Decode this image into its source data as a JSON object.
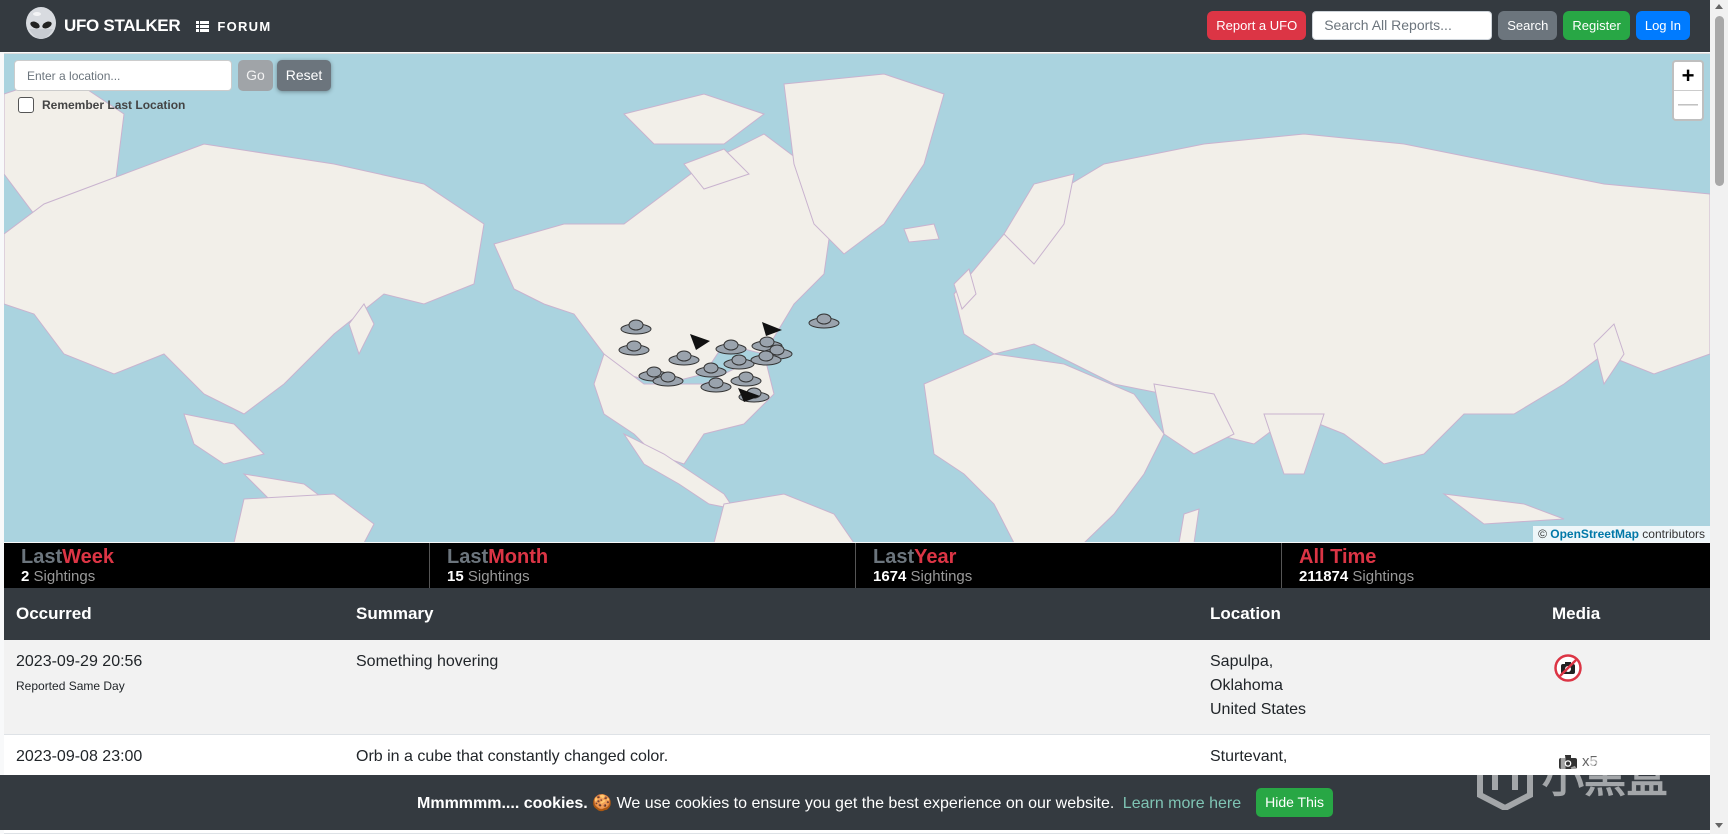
{
  "header": {
    "brand": "UFO STALKER",
    "forum_label": "FORUM",
    "report_button": "Report a UFO",
    "search_placeholder": "Search All Reports...",
    "search_button": "Search",
    "register_button": "Register",
    "login_button": "Log In"
  },
  "map": {
    "location_placeholder": "Enter a location...",
    "go_button": "Go",
    "reset_button": "Reset",
    "remember_label": "Remember Last Location",
    "zoom_in": "+",
    "zoom_out": "—",
    "attribution_prefix": "©",
    "attribution_link": "OpenStreetMap",
    "attribution_suffix": "contributors",
    "colors": {
      "water": "#aad3df",
      "land": "#f2efe9",
      "border": "#c9b3cf"
    }
  },
  "stats": [
    {
      "prefix": "Last",
      "highlight": "Week",
      "count": "2",
      "unit": "Sightings"
    },
    {
      "prefix": "Last",
      "highlight": "Month",
      "count": "15",
      "unit": "Sightings"
    },
    {
      "prefix": "Last",
      "highlight": "Year",
      "count": "1674",
      "unit": "Sightings"
    },
    {
      "prefix": "",
      "highlight": "All Time",
      "count": "211874",
      "unit": "Sightings"
    }
  ],
  "table": {
    "columns": [
      "Occurred",
      "Summary",
      "Location",
      "Media"
    ],
    "rows": [
      {
        "occurred": "2023-09-29 20:56",
        "reported": "Reported Same Day",
        "summary": "Something hovering",
        "location": [
          "Sapulpa,",
          "Oklahoma",
          "United States"
        ],
        "media": "no-camera-icon"
      },
      {
        "occurred": "2023-09-08 23:00",
        "summary": "Orb in a cube that constantly changed color.",
        "location": [
          "Sturtevant,"
        ],
        "media": "camera-icon",
        "media_count": "x5"
      }
    ]
  },
  "cookie": {
    "bold": "Mmmmmm.... cookies.",
    "emoji": "🍪",
    "text": "We use cookies to ensure you get the best experience on our website.",
    "link": "Learn more here",
    "button": "Hide This"
  },
  "watermark": "小黑盒"
}
